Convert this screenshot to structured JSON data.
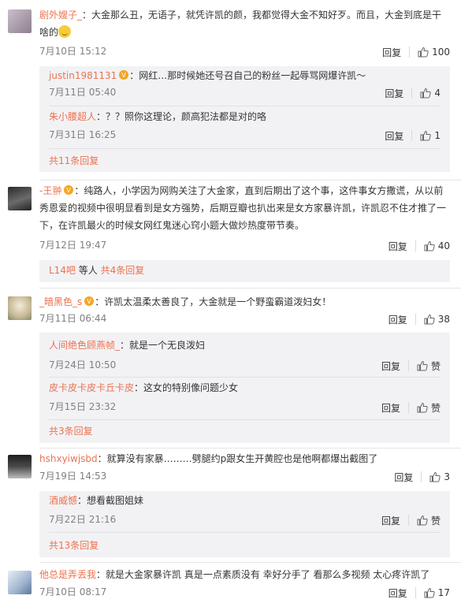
{
  "comments": [
    {
      "user": "剧外嫂子_",
      "text": "：大金那么丑，无语子，就凭许凯的颜，我都觉得大金不知好歹。而且，大金到底是干啥的",
      "date": "7月10日 15:12",
      "reply_label": "回复",
      "likes": "100",
      "replies": [
        {
          "user": "justin1981131",
          "text": "：网红…那时候她还号召自己的粉丝一起辱骂网爆许凯～",
          "date": "7月11日 05:40",
          "reply_label": "回复",
          "likes": "4"
        },
        {
          "user": "朱小腰超人",
          "text": "：？？照你这理论，颜高犯法都是对的咯",
          "date": "7月31日 16:25",
          "reply_label": "回复",
          "likes": "1"
        }
      ],
      "more": "共11条回复"
    },
    {
      "user": "-王翀",
      "text_lines": [
        "：纯路人，小学因为网购关注了大金家，直到后期出了这个事，这件事女方撒谎，从以前",
        "秀恩爱的视频中很明显看到是女方强势，后期豆瓣也扒出来是女方家暴许凯，许凯忍不住才推了一",
        "下，在许凯最火的时候女网红鬼迷心窍小题大做炒热度带节奏。"
      ],
      "date": "7月12日 19:47",
      "reply_label": "回复",
      "likes": "40",
      "preview_user": "L14吧",
      "preview_text": "等人",
      "more": "共4条回复"
    },
    {
      "user": "_暗黑色_s",
      "text": "：许凯太温柔太善良了，大金就是一个野蛮霸道泼妇女！",
      "date": "7月11日 06:44",
      "reply_label": "回复",
      "likes": "38",
      "replies": [
        {
          "user": "人间绝色顾燕帧_",
          "text": "：就是一个无良泼妇",
          "date": "7月24日 10:50",
          "reply_label": "回复",
          "likes": "赞"
        },
        {
          "user": "皮卡皮卡皮卡丘卡皮",
          "text": "：这女的特别像问题少女",
          "date": "7月15日 23:32",
          "reply_label": "回复",
          "likes": "赞"
        }
      ],
      "more": "共3条回复"
    },
    {
      "user": "hshxyiwjsbd",
      "text": "：就算没有家暴………劈腿约p跟女生开黄腔也是他啊都爆出截图了",
      "date": "7月19日 14:53",
      "reply_label": "回复",
      "likes": "3",
      "replies": [
        {
          "user": "酒威憾",
          "text": "：想看截图姐妹",
          "date": "7月22日 21:16",
          "reply_label": "回复",
          "likes": "赞"
        }
      ],
      "more": "共13条回复"
    },
    {
      "user": "他总是弄丢我",
      "text": "：就是大金家暴许凯 真是一点素质没有 幸好分手了 看那么多视频 太心疼许凯了",
      "date": "7月10日 08:17",
      "reply_label": "回复",
      "likes": "17"
    }
  ],
  "colors": {
    "username": "#eb7350",
    "sub_bg": "#f2f2f5",
    "meta": "#808080"
  },
  "icons": [
    "thumbs-up-icon",
    "verified-badge-icon",
    "smile-emoji-icon"
  ]
}
